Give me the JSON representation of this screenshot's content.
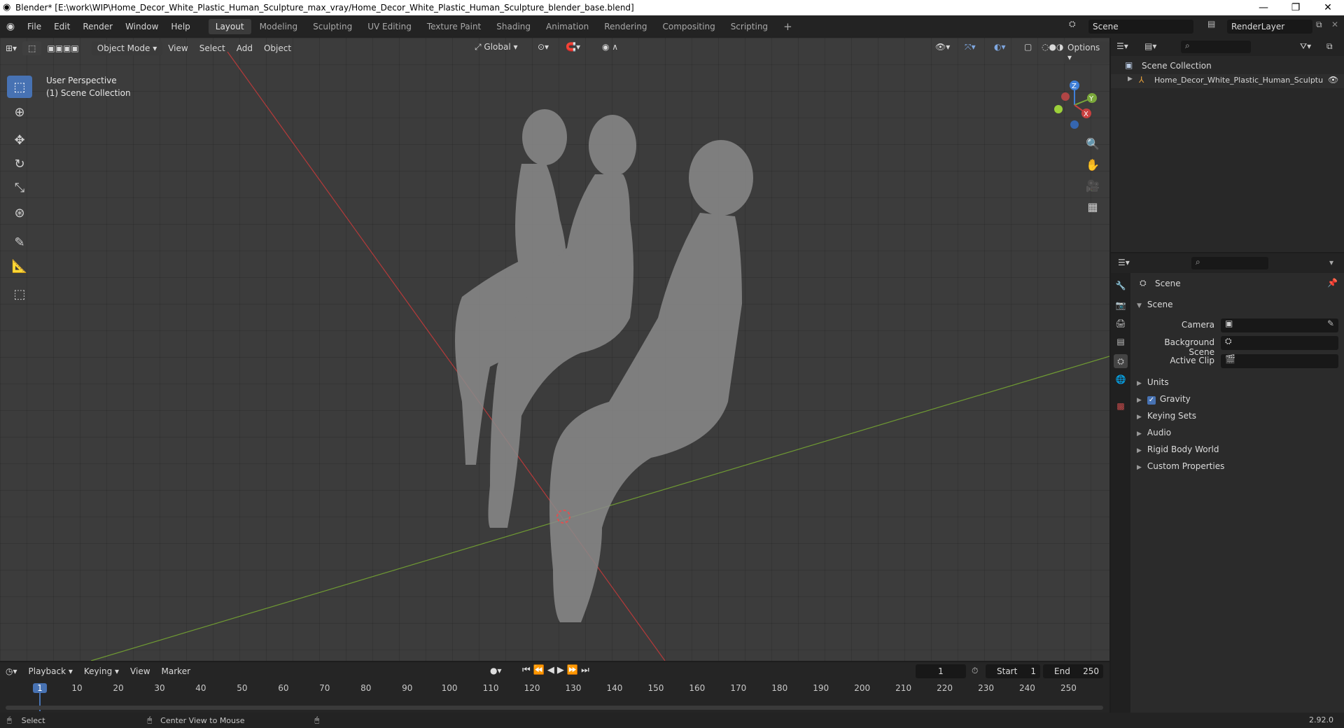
{
  "window": {
    "title": "Blender* [E:\\work\\WIP\\Home_Decor_White_Plastic_Human_Sculpture_max_vray/Home_Decor_White_Plastic_Human_Sculpture_blender_base.blend]",
    "minimize": "—",
    "restore": "❐",
    "close": "✕"
  },
  "menus": [
    "File",
    "Edit",
    "Render",
    "Window",
    "Help"
  ],
  "workspaces": [
    "Layout",
    "Modeling",
    "Sculpting",
    "UV Editing",
    "Texture Paint",
    "Shading",
    "Animation",
    "Rendering",
    "Compositing",
    "Scripting"
  ],
  "active_workspace": "Layout",
  "add_workspace": "+",
  "scene_field": "Scene",
  "renderlayer_field": "RenderLayer",
  "viewport": {
    "mode": "Object Mode",
    "menus": [
      "View",
      "Select",
      "Add",
      "Object"
    ],
    "transform_orientation": "Global",
    "options": "Options",
    "perspective": "User Perspective",
    "collection": "(1) Scene Collection"
  },
  "gizmo": {
    "z": "Z",
    "y": "Y",
    "x": "X"
  },
  "outliner": {
    "root": "Scene Collection",
    "item": "Home_Decor_White_Plastic_Human_Sculptu"
  },
  "properties": {
    "context": "Scene",
    "panel": "Scene",
    "camera_label": "Camera",
    "background_label": "Background Scene",
    "clip_label": "Active Clip",
    "subpanels": [
      "Units",
      "Gravity",
      "Keying Sets",
      "Audio",
      "Rigid Body World",
      "Custom Properties"
    ],
    "gravity_checked": true
  },
  "timeline": {
    "menus": [
      "Playback",
      "Keying",
      "View",
      "Marker"
    ],
    "current_frame": "1",
    "start_label": "Start",
    "start": "1",
    "end_label": "End",
    "end": "250",
    "ticks": [
      "1",
      "10",
      "20",
      "30",
      "40",
      "50",
      "60",
      "70",
      "80",
      "90",
      "100",
      "110",
      "120",
      "130",
      "140",
      "150",
      "160",
      "170",
      "180",
      "190",
      "200",
      "210",
      "220",
      "230",
      "240",
      "250"
    ]
  },
  "statusbar": {
    "select": "Select",
    "center": "Center View to Mouse",
    "version": "2.92.0"
  },
  "colors": {
    "accent": "#4772b3",
    "x_axis": "#c8403f",
    "y_axis": "#7aa83a",
    "z_axis": "#3f7fd8"
  }
}
